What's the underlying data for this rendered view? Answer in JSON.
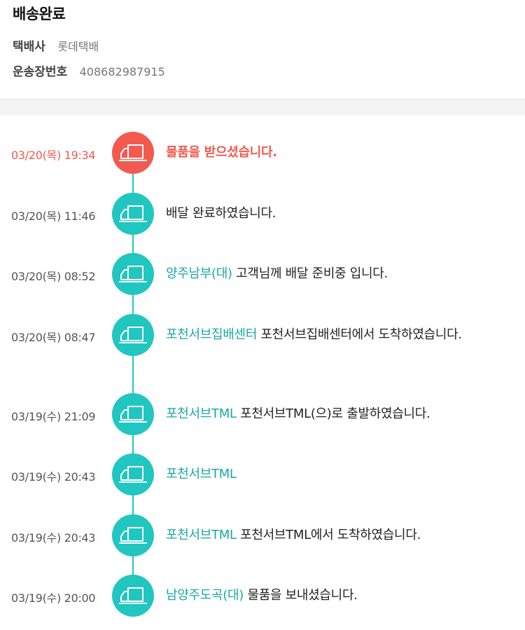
{
  "header": {
    "status_title": "배송완료",
    "carrier_label": "택배사",
    "carrier_value": "롯데택배",
    "tracking_label": "운송장번호",
    "tracking_value": "408682987915"
  },
  "colors": {
    "accent_teal": "#21c6c0",
    "location_teal": "#1aa8a3",
    "current_red": "#f25a50"
  },
  "events": [
    {
      "time": "03/20(목) 19:34",
      "location": "",
      "message": "물품을 받으셨습니다.",
      "icon": "truck-icon"
    },
    {
      "time": "03/20(목) 11:46",
      "location": "",
      "message": "배달 완료하였습니다.",
      "icon": "truck-icon"
    },
    {
      "time": "03/20(목) 08:52",
      "location": "양주남부(대)",
      "message": "고객님께 배달 준비중 입니다.",
      "icon": "truck-icon"
    },
    {
      "time": "03/20(목) 08:47",
      "location": "포천서브집배센터",
      "message": "포천서브집배센터에서 도착하였습니다.",
      "icon": "truck-icon"
    },
    {
      "time": "03/19(수) 21:09",
      "location": "포천서브TML",
      "message": "포천서브TML(으)로 출발하였습니다.",
      "icon": "truck-icon"
    },
    {
      "time": "03/19(수) 20:43",
      "location": "포천서브TML",
      "message": "",
      "icon": "truck-icon"
    },
    {
      "time": "03/19(수) 20:43",
      "location": "포천서브TML",
      "message": "포천서브TML에서 도착하였습니다.",
      "icon": "truck-icon"
    },
    {
      "time": "03/19(수) 20:00",
      "location": "남양주도곡(대)",
      "message": "물품을 보내셨습니다.",
      "icon": "truck-icon"
    }
  ]
}
